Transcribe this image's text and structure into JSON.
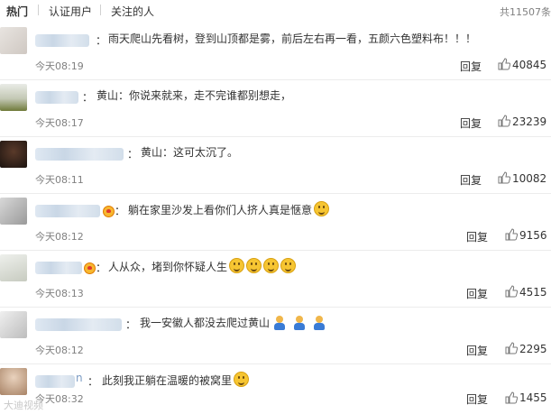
{
  "tabs": [
    {
      "label": "热门",
      "active": true
    },
    {
      "label": "认证用户",
      "active": false
    },
    {
      "label": "关注的人",
      "active": false
    }
  ],
  "total_label": "共11507条",
  "reply_label": "回复",
  "comments": [
    {
      "text": "雨天爬山先看树，登到山顶都是雾，前后左右再一看，五颜六色塑料布！！！",
      "time": "今天08:19",
      "likes": "40845"
    },
    {
      "text": "黄山：你说来就来，走不完谁都别想走，",
      "time": "今天08:17",
      "likes": "23239"
    },
    {
      "text": "黄山：这可太沉了。",
      "time": "今天08:11",
      "likes": "10082"
    },
    {
      "text": "躺在家里沙发上看你们人挤人真是惬意",
      "time": "今天08:12",
      "likes": "9156"
    },
    {
      "text": "人从众，堵到你怀疑人生",
      "time": "今天08:13",
      "likes": "4515"
    },
    {
      "text": "我一安徽人都没去爬过黄山",
      "time": "今天08:12",
      "likes": "2295"
    },
    {
      "text": "此刻我正躺在温暖的被窝里",
      "time": "今天08:32",
      "likes": "1455",
      "name_visible": "n"
    }
  ],
  "watermark": "大迪视频",
  "icons": {
    "thumb": "thumbs-up-icon",
    "emoji": "grin-emoji-icon",
    "badge": "member-badge-icon",
    "figure": "person-emoji-icon"
  },
  "colors": {
    "meta_text": "#808080",
    "divider": "#ececec",
    "name_blur": "#c9d7e6"
  }
}
